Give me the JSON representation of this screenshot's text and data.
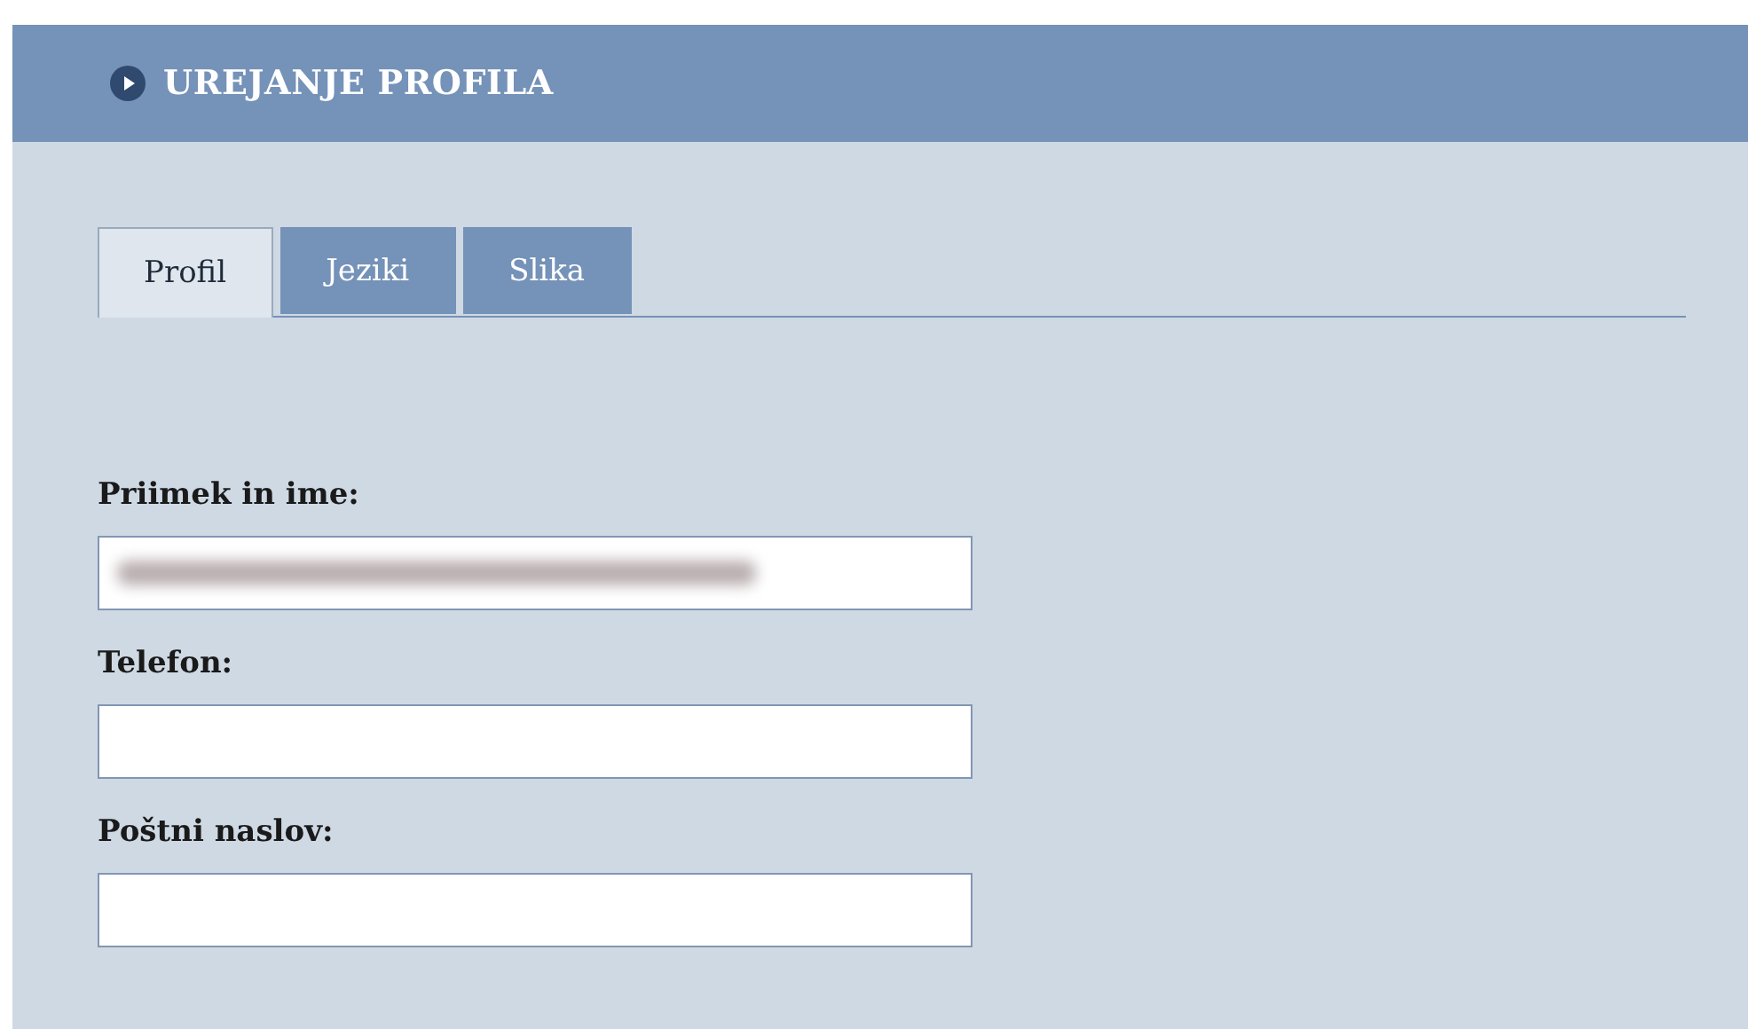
{
  "header": {
    "title": "UREJANJE PROFILA"
  },
  "tabs": [
    {
      "label": "Profil",
      "selected": true
    },
    {
      "label": "Jeziki",
      "selected": false
    },
    {
      "label": "Slika",
      "selected": false
    }
  ],
  "fields": [
    {
      "label": "Priimek in ime:",
      "redacted": true
    },
    {
      "label": "Telefon:",
      "redacted": false
    },
    {
      "label": "Poštni naslov:",
      "redacted": false
    }
  ]
}
